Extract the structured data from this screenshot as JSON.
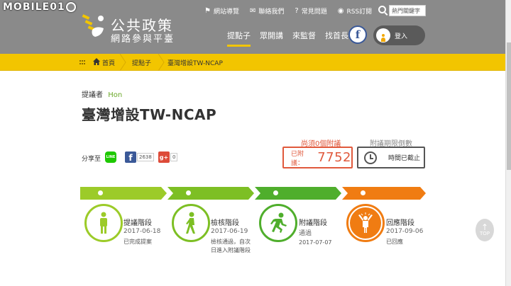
{
  "watermark": "MOBILE01",
  "site": {
    "title_line1": "公共政策",
    "title_line2": "網路參與平臺"
  },
  "toplinks": [
    {
      "icon": "sitemap-icon",
      "glyph": "⚑",
      "label": "網站導覽"
    },
    {
      "icon": "mail-icon",
      "glyph": "✉",
      "label": "聯絡我們"
    },
    {
      "icon": "question-icon",
      "glyph": "?",
      "label": "常見問題"
    },
    {
      "icon": "rss-icon",
      "glyph": "◉",
      "label": "RSS訂閱"
    }
  ],
  "search": {
    "placeholder": "",
    "value": "熱門關鍵字"
  },
  "nav": [
    {
      "label": "提點子",
      "active": true
    },
    {
      "label": "眾開講",
      "active": false
    },
    {
      "label": "來監督",
      "active": false
    },
    {
      "label": "找首長",
      "active": false
    }
  ],
  "facebook_letter": "f",
  "login_label": "登入",
  "breadcrumb": {
    "home": "首頁",
    "level1": "提點子",
    "level2": "臺灣增設TW-NCAP"
  },
  "proposal": {
    "proposer_label": "提議者",
    "proposer_name": "Hon",
    "title": "臺灣增設TW-NCAP"
  },
  "share": {
    "label": "分享至",
    "line_label": "LINE",
    "fb_letter": "f",
    "fb_count": "2638",
    "gplus_label": "g+",
    "gplus_count": "0"
  },
  "seconds": {
    "need_label": "尚須0個附議",
    "count_label": "已附議：",
    "count_value": "7752",
    "deadline_label": "附議期限倒數",
    "deadline_text": "時間已截止"
  },
  "stages": [
    {
      "title": "提議階段",
      "date": "2017-06-18",
      "status": "已完成提案",
      "color": "#9ccb29",
      "icon": "person-standing-icon"
    },
    {
      "title": "檢核階段",
      "date": "2017-06-19",
      "status": "檢核通過，自次日進入附議階段",
      "color": "#7dbf24",
      "icon": "person-walking-icon"
    },
    {
      "title": "附議階段",
      "date": "2017-07-07",
      "status": "通過",
      "color": "#4fae2c",
      "icon": "person-running-icon"
    },
    {
      "title": "回應階段",
      "date": "2017-09-06",
      "status": "已回應",
      "color": "#f07c12",
      "icon": "person-celebrating-icon"
    }
  ],
  "top_button_label": "TOP"
}
